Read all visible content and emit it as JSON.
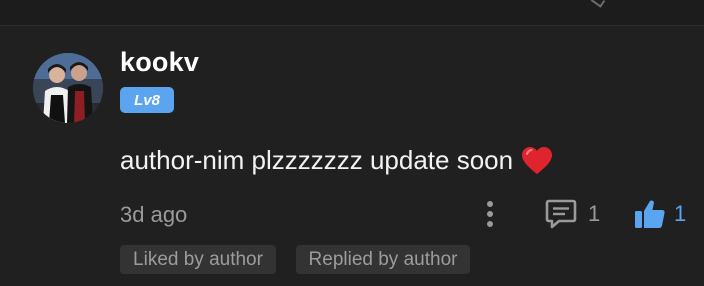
{
  "comment": {
    "username": "kookv",
    "level": "Lv8",
    "text": "author-nim plzzzzzzz update soon",
    "timestamp": "3d ago",
    "reply_count": "1",
    "like_count": "1",
    "tags": [
      "Liked by author",
      "Replied by author"
    ]
  },
  "icons": {
    "reaction": "red-heart-icon",
    "more": "more-vertical-icon",
    "reply": "comment-icon",
    "like": "thumbs-up-icon"
  },
  "colors": {
    "background": "#202020",
    "accent": "#5aa4f0",
    "heart": "#e0242d",
    "muted_text": "#9a9a9a",
    "tag_background": "#333333"
  }
}
